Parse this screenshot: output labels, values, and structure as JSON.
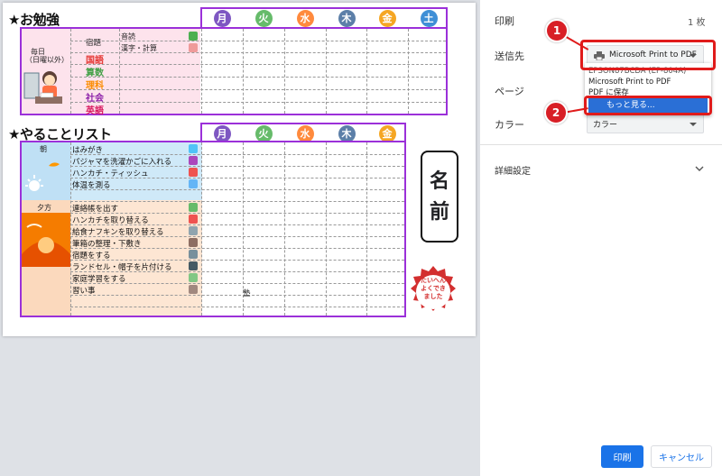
{
  "study": {
    "title": "★お勉強",
    "row_label_1": "毎日",
    "row_label_2": "（日曜以外）",
    "homework_label": "宿題",
    "items": [
      "音読",
      "漢字・計算"
    ],
    "subjects": [
      {
        "name": "国語",
        "color": "#e53935"
      },
      {
        "name": "算数",
        "color": "#43a047"
      },
      {
        "name": "理科",
        "color": "#fb8c00"
      },
      {
        "name": "社会",
        "color": "#8e24aa"
      },
      {
        "name": "英語",
        "color": "#d81b60"
      }
    ],
    "days": [
      {
        "label": "月",
        "color": "#7e57c2"
      },
      {
        "label": "火",
        "color": "#66bb6a"
      },
      {
        "label": "水",
        "color": "#ff8a3d"
      },
      {
        "label": "木",
        "color": "#5c7fa8"
      },
      {
        "label": "金",
        "color": "#f5a623"
      },
      {
        "label": "土",
        "color": "#3f8fd6"
      }
    ]
  },
  "todo": {
    "title": "★やることリスト",
    "morning_label": "朝",
    "evening_label": "夕方",
    "morning_items": [
      "はみがき",
      "パジャマを洗濯かごに入れる",
      "ハンカチ・ティッシュ",
      "体温を測る"
    ],
    "evening_items": [
      "連絡帳を出す",
      "ハンカチを取り替える",
      "給食ナフキンを取り替える",
      "筆箱の整理・下敷き",
      "宿題をする",
      "ランドセル・帽子を片付ける",
      "家庭学習をする",
      "習い事"
    ],
    "cram_label": "塾",
    "days": [
      {
        "label": "月",
        "color": "#7e57c2"
      },
      {
        "label": "火",
        "color": "#66bb6a"
      },
      {
        "label": "水",
        "color": "#ff8a3d"
      },
      {
        "label": "木",
        "color": "#5c7fa8"
      },
      {
        "label": "金",
        "color": "#f5a623"
      }
    ]
  },
  "name_box": {
    "char1": "名",
    "char2": "前"
  },
  "stamp": {
    "line1": "たいへん",
    "line2": "よくでき",
    "line3": "ました"
  },
  "panel": {
    "print_label": "印刷",
    "sheet_count": "1 枚",
    "destination_label": "送信先",
    "destination_value": "Microsoft Print to PDF",
    "pages_label": "ページ",
    "color_label": "カラー",
    "color_value": "カラー",
    "more_settings": "詳細設定",
    "print_button": "印刷",
    "cancel_button": "キャンセル"
  },
  "dropdown": {
    "items": [
      "EPSON87BCDA (EP-804A)",
      "Microsoft Print to PDF",
      "PDF に保存"
    ],
    "more": "もっと見る..."
  },
  "annotations": {
    "badge1": "1",
    "badge2": "2"
  }
}
